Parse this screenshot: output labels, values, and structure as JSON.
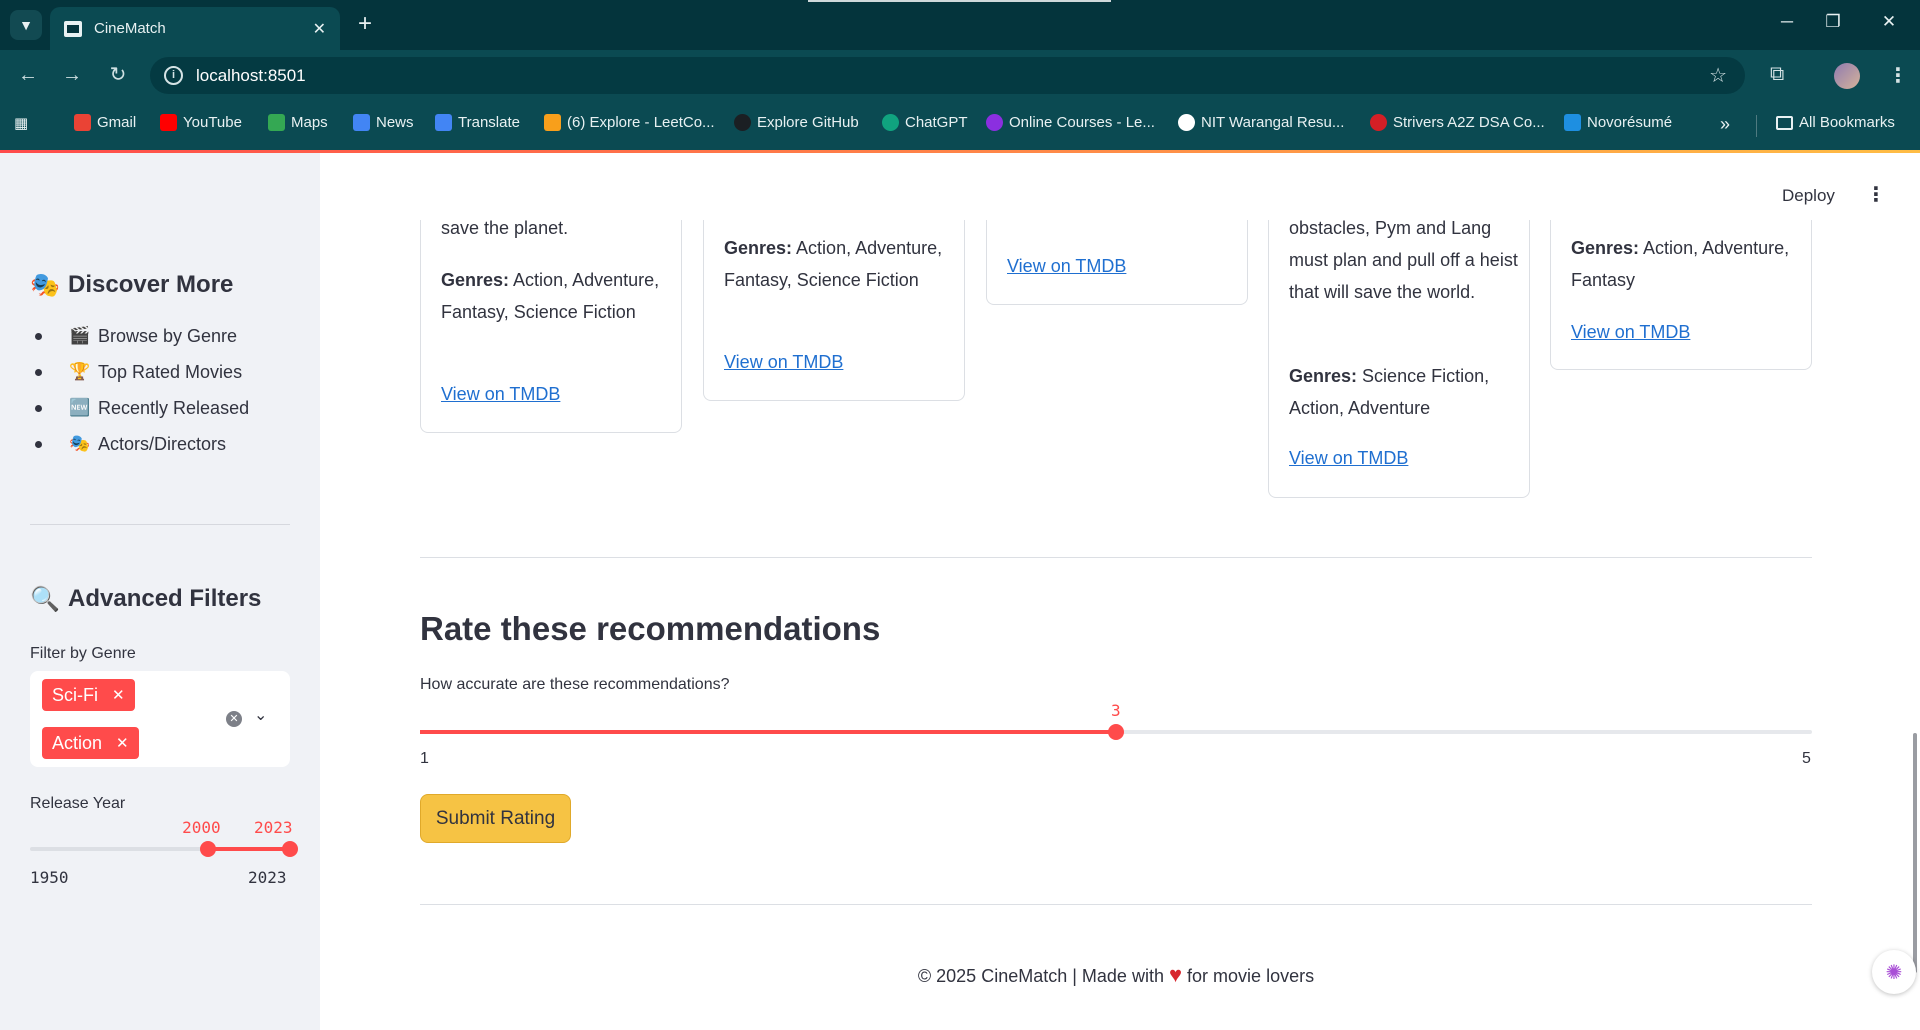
{
  "browser": {
    "tab_title": "CineMatch",
    "url": "localhost:8501",
    "bookmarks": [
      {
        "label": "Gmail",
        "color": "#ea4335"
      },
      {
        "label": "YouTube",
        "color": "#ff0000"
      },
      {
        "label": "Maps",
        "color": "#34a853"
      },
      {
        "label": "News",
        "color": "#4285f4"
      },
      {
        "label": "Translate",
        "color": "#4285f4"
      },
      {
        "label": "(6) Explore - LeetCo...",
        "color": "#f89f1b"
      },
      {
        "label": "Explore GitHub",
        "color": "#1b1f23"
      },
      {
        "label": "ChatGPT",
        "color": "#10a37f"
      },
      {
        "label": "Online Courses - Le...",
        "color": "#8b2fe0"
      },
      {
        "label": "NIT Warangal Resu...",
        "color": "#ffffff"
      },
      {
        "label": "Strivers A2Z DSA Co...",
        "color": "#d41f26"
      },
      {
        "label": "Novorésumé",
        "color": "#1e8fe1"
      }
    ],
    "all_bookmarks": "All Bookmarks"
  },
  "sidebar": {
    "discover_title": "Discover More",
    "discover_items": [
      {
        "label": "Browse by Genre",
        "emoji": "🎬"
      },
      {
        "label": "Top Rated Movies",
        "emoji": "🏆"
      },
      {
        "label": "Recently Released",
        "emoji": "🆕"
      },
      {
        "label": "Actors/Directors",
        "emoji": "🎭"
      }
    ],
    "filters_title": "Advanced Filters",
    "genre_label": "Filter by Genre",
    "genre_chips": [
      "Sci-Fi",
      "Action"
    ],
    "year_label": "Release Year",
    "year_range": {
      "low": 2000,
      "high": 2023,
      "min": 1950,
      "max": 2023,
      "low_text": "2000",
      "high_text": "2023",
      "min_text": "1950",
      "max_text": "2023"
    }
  },
  "header": {
    "deploy": "Deploy"
  },
  "cards": [
    {
      "top_text": "save the planet.",
      "genres_label": "Genres:",
      "genres": "Action, Adventure, Fantasy, Science Fiction",
      "link": "View on TMDB"
    },
    {
      "top_text": "",
      "genres_label": "Genres:",
      "genres": "Action, Adventure, Fantasy, Science Fiction",
      "link": "View on TMDB"
    },
    {
      "top_text": "",
      "genres_label": "",
      "genres": "",
      "link": "View on TMDB"
    },
    {
      "top_text": "obstacles, Pym and Lang must plan and pull off a heist that will save the world.",
      "genres_label": "Genres:",
      "genres": "Science Fiction, Action, Adventure",
      "link": "View on TMDB"
    },
    {
      "top_text": "",
      "genres_label": "Genres:",
      "genres": "Action, Adventure, Fantasy",
      "link": "View on TMDB"
    }
  ],
  "rating": {
    "title": "Rate these recommendations",
    "question": "How accurate are these recommendations?",
    "value": 3,
    "min": 1,
    "max": 5,
    "value_text": "3",
    "min_text": "1",
    "max_text": "5",
    "submit_label": "Submit Rating"
  },
  "footer": {
    "before": "© 2025 CineMatch | Made with",
    "after": "for movie lovers"
  },
  "colors": {
    "accent": "#ff4b4b",
    "button": "#f6c344",
    "chrome": "#0b4a52",
    "link": "#1f6fd0"
  }
}
